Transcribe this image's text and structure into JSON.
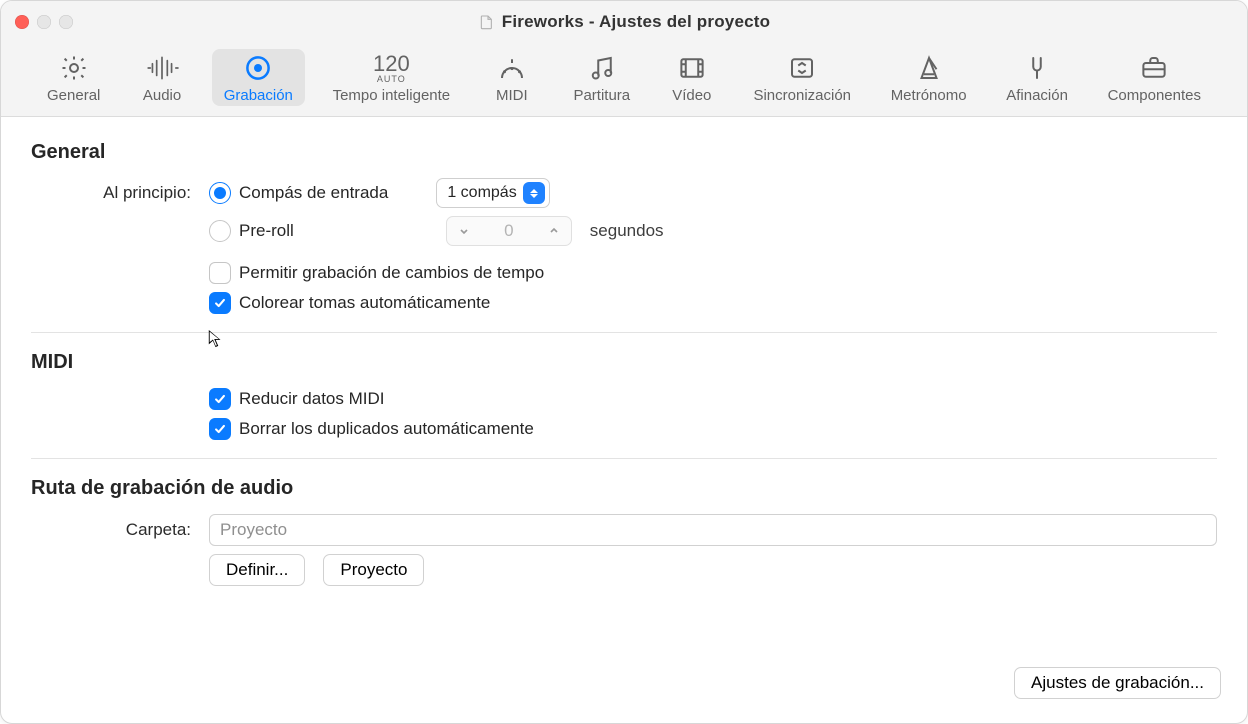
{
  "window": {
    "title": "Fireworks - Ajustes del proyecto"
  },
  "toolbar": {
    "general": "General",
    "audio": "Audio",
    "recording": "Grabación",
    "smart_tempo": "Tempo inteligente",
    "midi": "MIDI",
    "score": "Partitura",
    "video": "Vídeo",
    "sync": "Sincronización",
    "metronome": "Metrónomo",
    "tuning": "Afinación",
    "assets": "Componentes",
    "tempo_number": "120",
    "tempo_auto": "AUTO"
  },
  "sections": {
    "general": "General",
    "midi": "MIDI",
    "audio_path": "Ruta de grabación de audio"
  },
  "general": {
    "start_label": "Al principio:",
    "countin_label": "Compás de entrada",
    "countin_value": "1 compás",
    "preroll_label": "Pre-roll",
    "preroll_value": "0",
    "preroll_unit": "segundos",
    "allow_tempo_label": "Permitir grabación de cambios de tempo",
    "auto_color_label": "Colorear tomas automáticamente"
  },
  "midi": {
    "reduce_label": "Reducir datos MIDI",
    "erase_dup_label": "Borrar los duplicados automáticamente"
  },
  "audio_path": {
    "folder_label": "Carpeta:",
    "folder_value": "Proyecto",
    "set_btn": "Definir...",
    "project_btn": "Proyecto"
  },
  "footer": {
    "rec_settings_btn": "Ajustes de grabación..."
  }
}
